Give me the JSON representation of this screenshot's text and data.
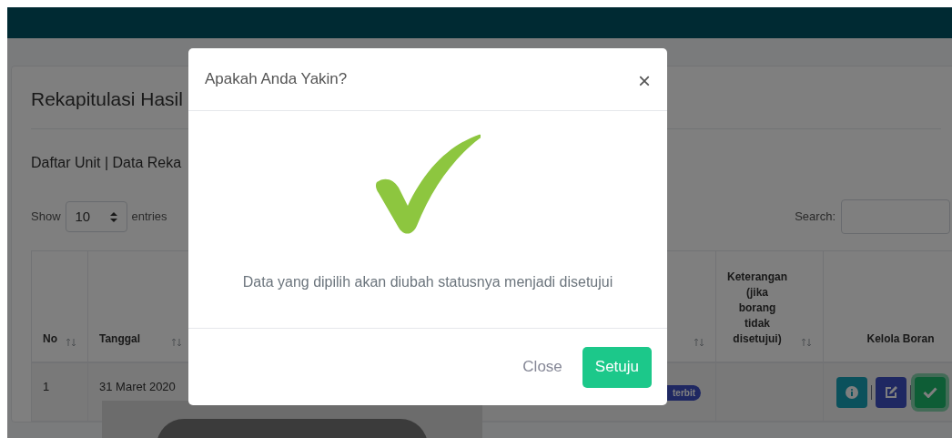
{
  "page": {
    "title": "Rekapitulasi Hasil",
    "subtitle": "Daftar Unit | Data Reka",
    "length_before": "Show",
    "length_value": "10",
    "length_after": "entries",
    "search_label": "Search:"
  },
  "table": {
    "columns": [
      {
        "label": "No",
        "sortable": true
      },
      {
        "label": "Tanggal",
        "sortable": true
      },
      {},
      {
        "sortable": true
      },
      {
        "label": "Keterangan (jika borang tidak disetujui)",
        "sortable": true
      },
      {
        "label": "Kelola Boran",
        "sortable": false
      }
    ],
    "rows": [
      {
        "no": "1",
        "date": "31 Maret 2020",
        "badge": "terbit",
        "actions": [
          {
            "kind": "info",
            "focused": false
          },
          {
            "kind": "edit",
            "focused": false
          },
          {
            "kind": "approve",
            "focused": true
          }
        ]
      }
    ]
  },
  "modal": {
    "title": "Apakah Anda Yakin?",
    "close": "×",
    "message": "Data yang dipilih akan diubah statusnya menjadi disetujui",
    "buttons": [
      {
        "label": "Close",
        "kind": "secondary"
      },
      {
        "label": "Setuju",
        "kind": "primary"
      }
    ]
  }
}
